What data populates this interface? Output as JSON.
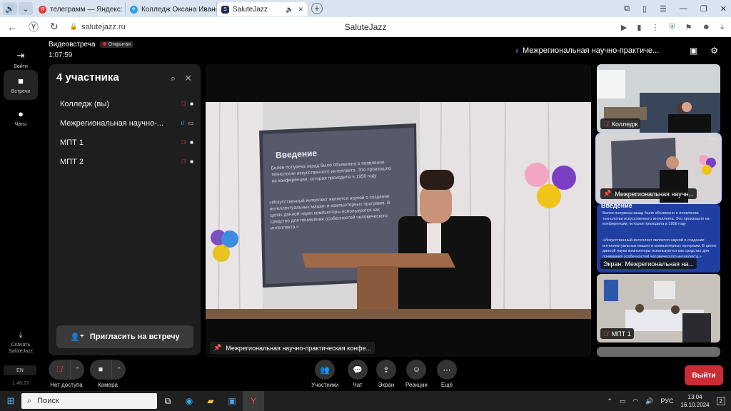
{
  "browser": {
    "tabs": [
      {
        "label": "телеграмм — Яндекс: нас",
        "color": "#e53935",
        "letter": "Я"
      },
      {
        "label": "Колледж Оксана Иванов",
        "color": "#2aa3df",
        "letter": "✈"
      },
      {
        "label": "SalutеJazz",
        "color": "#1e2c52",
        "letter": "S"
      }
    ],
    "address": "salutejazz.ru",
    "page_title": "SaluteJazz"
  },
  "rail": {
    "items": [
      {
        "label": "Войти"
      },
      {
        "label": "Встречи"
      },
      {
        "label": "Чаты"
      }
    ],
    "download_label": "Скачать SaluteJazz",
    "lang": "EN",
    "version": "1.48.27"
  },
  "meeting": {
    "title": "Видеовстреча",
    "status": "Открытая",
    "timer": "1:07:59",
    "speaker": "Межрегиональная научно-практиче..."
  },
  "participants": {
    "title": "4 участника",
    "items": [
      {
        "name": "Колледж (вы)",
        "mic": "off",
        "dev": "cam"
      },
      {
        "name": "Межрегиональная научно-...",
        "mic": "on",
        "dev": "screen"
      },
      {
        "name": "МПТ 1",
        "mic": "off",
        "dev": "cam"
      },
      {
        "name": "МПТ 2",
        "mic": "off",
        "dev": "cam"
      }
    ],
    "invite_label": "Пригласить на встречу"
  },
  "stage": {
    "label": "Межрегиональная научно-практическая конфе...",
    "slide": {
      "heading": "Введение",
      "p1": "Более полувека назад было объявлено о появлении технологии искусственного интеллекта. Это произошло на конференции, которая проходила в 1956 году",
      "p2": "«Искусственный интеллект является наукой о создании интеллектуальных машин и компьютерных программ. В целях данной науки компьютеры используются как средство для понимания особенностей человеческого интеллекта.»"
    }
  },
  "thumbs": [
    {
      "label": "Колледж"
    },
    {
      "label": "Межрегиональная научн..."
    },
    {
      "label": "Экран: Межрегиональная на...",
      "year": "1956 год"
    },
    {
      "label": "МПТ 1"
    }
  ],
  "controls": {
    "mic": "Нет доступа",
    "camera": "Камера",
    "participants": "Участники",
    "chat": "Чат",
    "screen": "Экран",
    "reactions": "Реакции",
    "more": "Ещё",
    "leave": "Выйти"
  },
  "taskbar": {
    "search": "Поиск",
    "lang": "РУС",
    "time": "13:04",
    "date": "16.10.2024",
    "notif": "2"
  }
}
